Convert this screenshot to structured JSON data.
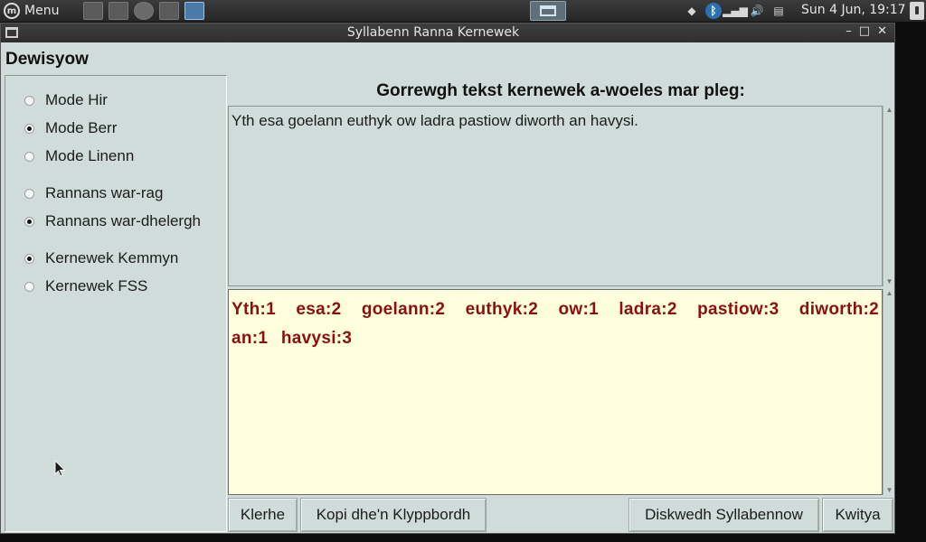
{
  "panel": {
    "menu_label": "Menu",
    "clock": "Sun  4 Jun, 19:17"
  },
  "window": {
    "title": "Syllabenn Ranna Kernewek"
  },
  "options": {
    "title": "Dewisyow",
    "groups": [
      [
        {
          "label": "Mode Hir",
          "selected": false
        },
        {
          "label": "Mode Berr",
          "selected": true
        },
        {
          "label": "Mode Linenn",
          "selected": false
        }
      ],
      [
        {
          "label": "Rannans war-rag",
          "selected": false
        },
        {
          "label": "Rannans war-dhelergh",
          "selected": true
        }
      ],
      [
        {
          "label": "Kernewek Kemmyn",
          "selected": true
        },
        {
          "label": "Kernewek FSS",
          "selected": false
        }
      ]
    ]
  },
  "main": {
    "prompt": "Gorrewgh tekst kernewek a-woeles mar pleg:",
    "input_text": "Yth esa goelann euthyk ow ladra pastiow diworth an havysi.",
    "output_text": "Yth:1 esa:2 goelann:2 euthyk:2 ow:1 ladra:2 pastiow:3 diworth:2 an:1 havysi:3"
  },
  "buttons": {
    "clear": "Klerhe",
    "copy": "Kopi dhe'n Klyppbordh",
    "finish": "Diskwedh Syllabennow",
    "quit": "Kwitya"
  },
  "colors": {
    "window_bg": "#cfdcd9",
    "output_bg": "#fffedd",
    "output_text": "#8a0f0f"
  }
}
